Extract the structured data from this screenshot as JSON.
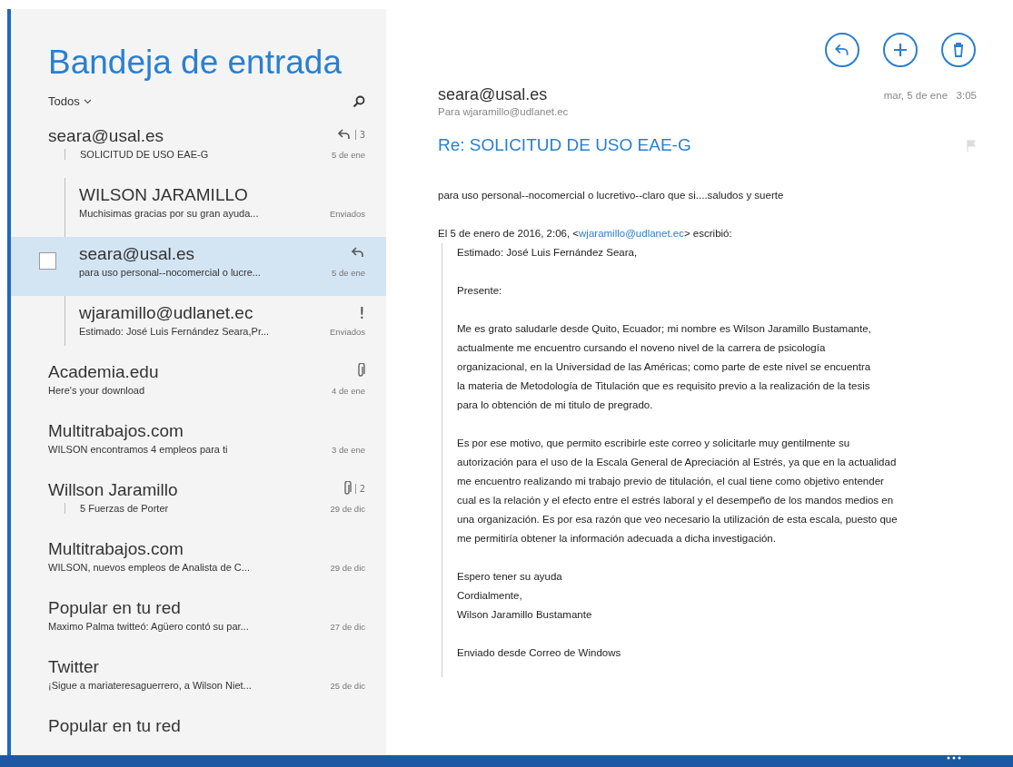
{
  "inbox": {
    "title": "Bandeja de entrada",
    "filter": "Todos"
  },
  "messages": [
    {
      "threaded": true,
      "sender": "seara@usal.es",
      "subject": "SOLICITUD DE USO EAE-G",
      "date": "5 de ene",
      "replied": true,
      "attachment": false,
      "count": "3",
      "selected": false,
      "children": [
        {
          "sender": "WILSON JARAMILLO",
          "subject": "Muchisimas gracias por su gran ayuda...",
          "date": "Enviados",
          "replied": false,
          "attachment": false,
          "selected": false
        },
        {
          "sender": "seara@usal.es",
          "subject": "para uso personal--nocomercial o lucre...",
          "date": "5 de ene",
          "replied": true,
          "attachment": false,
          "selected": true,
          "checked": false
        },
        {
          "sender": "wjaramillo@udlanet.ec",
          "subject": "Estimado: José Luis Fernández Seara,Pr...",
          "date": "Enviados",
          "mark": "!",
          "replied": false,
          "attachment": false,
          "selected": false
        }
      ]
    },
    {
      "threaded": false,
      "sender": "Academia.edu",
      "subject": "Here's your download",
      "date": "4 de ene",
      "replied": false,
      "attachment": true,
      "selected": false
    },
    {
      "threaded": false,
      "sender": "Multitrabajos.com",
      "subject": "WILSON encontramos 4 empleos para ti",
      "date": "3 de ene",
      "replied": false,
      "attachment": false,
      "selected": false
    },
    {
      "threaded": true,
      "sender": "Willson Jaramillo",
      "subject": "5 Fuerzas de Porter",
      "date": "29 de dic",
      "replied": false,
      "attachment": true,
      "count": "2",
      "selected": false
    },
    {
      "threaded": false,
      "sender": "Multitrabajos.com",
      "subject": "WILSON, nuevos empleos de Analista de C...",
      "date": "29 de dic",
      "replied": false,
      "attachment": false,
      "selected": false
    },
    {
      "threaded": false,
      "sender": "Popular en tu red",
      "subject": "Maximo Palma twitteó: Agüero contó su par...",
      "date": "27 de dic",
      "replied": false,
      "attachment": false,
      "selected": false
    },
    {
      "threaded": false,
      "sender": "Twitter",
      "subject": "¡Sigue a mariateresaguerrero, a Wilson Niet...",
      "date": "25 de dic",
      "replied": false,
      "attachment": false,
      "selected": false
    },
    {
      "sender": "Popular en tu red",
      "replied": false,
      "attachment": false,
      "selected": false
    }
  ],
  "reading": {
    "from": "seara@usal.es",
    "to_label": "Para",
    "to": "wjaramillo@udlanet.ec",
    "date": "mar, 5 de ene",
    "time": "3:05",
    "subject": "Re: SOLICITUD DE USO EAE-G",
    "reply": "para uso personal--nocomercial o lucretivo--claro que si....saludos y suerte",
    "quote_header": {
      "before": "El 5 de enero de 2016, 2:06, <",
      "link": "wjaramillo@udlanet.ec",
      "after": "> escribió:"
    },
    "quote": [
      [
        "Estimado: José Luis Fernández Seara,"
      ],
      [
        "Presente:"
      ],
      [
        "Me es grato saludarle desde Quito, Ecuador; mi nombre es Wilson Jaramillo Bustamante,",
        "actualmente me encuentro cursando el noveno nivel de la carrera de psicología",
        "organizacional, en la Universidad de las Américas; como parte de este nivel se encuentra",
        "la materia de Metodología de Titulación que es requisito previo a la realización  de la tesis",
        "para lo obtención de mi  titulo de pregrado."
      ],
      [
        "Es por ese motivo, que permito escribirle este correo y solicitarle muy gentilmente su",
        "autorización para el uso de la Escala General de Apreciación al Estrés, ya que en la actualidad",
        "me encuentro realizando mi trabajo previo de titulación, el cual tiene como objetivo entender",
        "cual es la relación y el efecto entre el estrés laboral y el desempeño de los mandos medios en",
        "una organización. Es por esa razón que veo necesario la utilización de esta escala, puesto que",
        "me permitiría obtener la información adecuada a dicha investigación."
      ],
      [
        "Espero tener su ayuda",
        "Cordialmente,",
        "Wilson Jaramillo Bustamante"
      ],
      [
        "Enviado desde Correo de Windows"
      ]
    ]
  }
}
